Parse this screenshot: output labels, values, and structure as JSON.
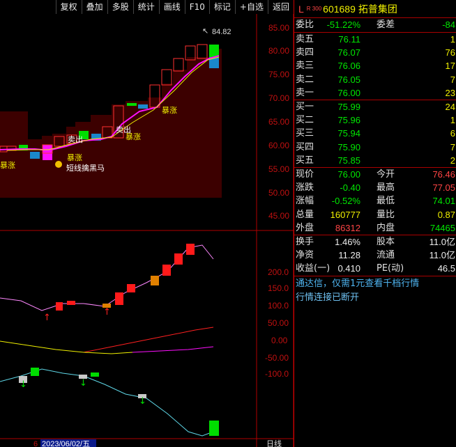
{
  "toolbar": {
    "items": [
      "复权",
      "叠加",
      "多股",
      "统计",
      "画线",
      "F10",
      "标记",
      "+自选",
      "返回"
    ]
  },
  "stock": {
    "market_flag": "L",
    "code": "601689",
    "name": "拓普集团",
    "board": "R 300"
  },
  "orderbook": {
    "weibi_label": "委比",
    "weibi_value": "-51.22%",
    "weicha_label": "委差",
    "weicha_value": "-84",
    "sell": [
      {
        "label": "卖五",
        "price": "76.11",
        "vol": "1"
      },
      {
        "label": "卖四",
        "price": "76.07",
        "vol": "76"
      },
      {
        "label": "卖三",
        "price": "76.06",
        "vol": "17"
      },
      {
        "label": "卖二",
        "price": "76.05",
        "vol": "7"
      },
      {
        "label": "卖一",
        "price": "76.00",
        "vol": "23"
      }
    ],
    "buy": [
      {
        "label": "买一",
        "price": "75.99",
        "vol": "24"
      },
      {
        "label": "买二",
        "price": "75.96",
        "vol": "1"
      },
      {
        "label": "买三",
        "price": "75.94",
        "vol": "6"
      },
      {
        "label": "买四",
        "price": "75.90",
        "vol": "7"
      },
      {
        "label": "买五",
        "price": "75.85",
        "vol": "2"
      }
    ]
  },
  "stats": [
    {
      "l1": "现价",
      "v1": "76.00",
      "l2": "今开",
      "v2": "76.46"
    },
    {
      "l1": "涨跌",
      "v1": "-0.40",
      "l2": "最高",
      "v2": "77.05"
    },
    {
      "l1": "涨幅",
      "v1": "-0.52%",
      "l2": "最低",
      "v2": "74.01"
    },
    {
      "l1": "总量",
      "v1": "160777",
      "l2": "量比",
      "v2": "0.87"
    },
    {
      "l1": "外盘",
      "v1": "86312",
      "l2": "内盘",
      "v2": "74465"
    }
  ],
  "finance": [
    {
      "l1": "换手",
      "v1": "1.46%",
      "l2": "股本",
      "v2": "11.0亿"
    },
    {
      "l1": "净资",
      "v1": "11.28",
      "l2": "流通",
      "v2": "11.0亿"
    },
    {
      "l1": "收益(一)",
      "v1": "0.410",
      "l2": "PE(动)",
      "v2": "46.5"
    }
  ],
  "notices": {
    "promo": "通达信，仅需1元查看千档行情",
    "status": "行情连接已断开"
  },
  "chart": {
    "main_axis": [
      "85.00",
      "80.00",
      "75.00",
      "70.00",
      "65.00",
      "60.00",
      "55.00",
      "50.00",
      "45.00"
    ],
    "high_marker": "84.82",
    "annotations": [
      "暴涨",
      "暴涨",
      "暴涨",
      "暴涨",
      "卖出",
      "卖出",
      "短线擒黑马"
    ],
    "sub_axis": [
      "200.0",
      "150.0",
      "100.0",
      "50.00",
      "0.00",
      "-50.00",
      "-100.0"
    ],
    "date_label": "2023/06/02/五",
    "bottom_left": "6",
    "period": "日线",
    "colors": {
      "up": "#ff1a1a",
      "down": "#00dd00",
      "ma": "#ff10ff",
      "background_fill": "#3c0000",
      "grid": "#b00000"
    }
  }
}
